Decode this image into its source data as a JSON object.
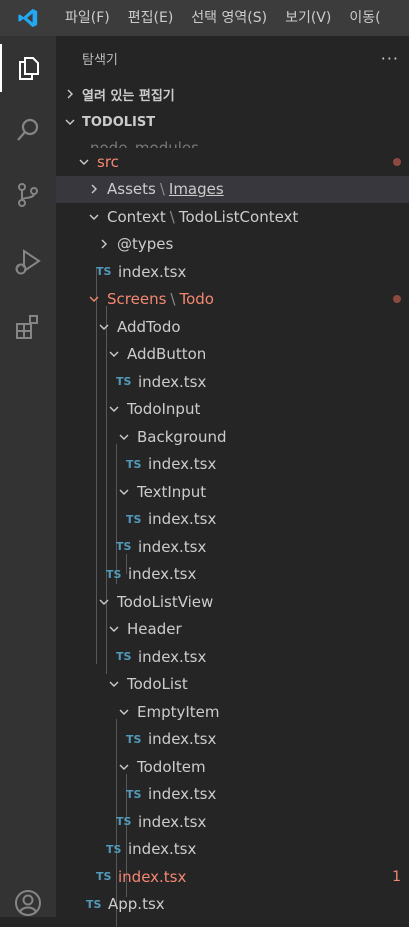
{
  "menu": [
    "파일(F)",
    "편집(E)",
    "선택 영역(S)",
    "보기(V)",
    "이동("
  ],
  "sidebar": {
    "title": "탐색기",
    "more": "···",
    "open_editors": "열려 있는 편집기",
    "project": "TODOLIST"
  },
  "tree": {
    "node_modules": "node_modules",
    "src": "src",
    "assets": "Assets",
    "images": "Images",
    "context": "Context",
    "todolistcontext": "TodoListContext",
    "types": "@types",
    "index": "index.tsx",
    "screens": "Screens",
    "todo": "Todo",
    "addtodo": "AddTodo",
    "addbutton": "AddButton",
    "todoinput": "TodoInput",
    "background": "Background",
    "textinput": "TextInput",
    "todolistview": "TodoListView",
    "header": "Header",
    "todolist": "TodoList",
    "emptyitem": "EmptyItem",
    "todoitem": "TodoItem",
    "app": "App.tsx",
    "ts_badge": "TS",
    "separator": "\\",
    "error_count": "1"
  },
  "colors": {
    "accent": "#007acc",
    "error": "#f48771",
    "ts_icon": "#519aba"
  }
}
